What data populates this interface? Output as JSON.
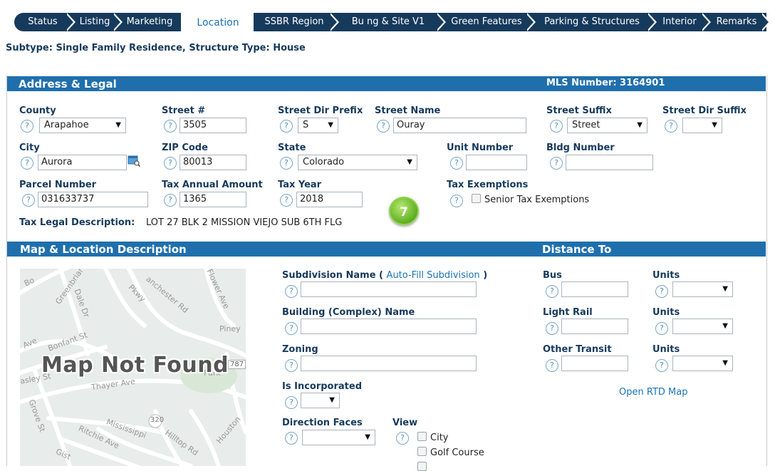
{
  "tabs": [
    "Status",
    "Listing",
    "Marketing",
    "Location",
    "SSBR Region",
    "Bu   ng & Site V1",
    "Green Features",
    "Parking & Structures",
    "Interior",
    "Remarks"
  ],
  "subtype": "Subtype: Single Family Residence, Structure Type: House",
  "address_section": {
    "title": "Address & Legal",
    "mls_number": "MLS Number: 3164901",
    "fields": {
      "county": {
        "label": "County",
        "value": "Arapahoe"
      },
      "street_number": {
        "label": "Street #",
        "value": "3505"
      },
      "street_dir_prefix": {
        "label": "Street Dir Prefix",
        "value": "S"
      },
      "street_name": {
        "label": "Street Name",
        "value": "Ouray"
      },
      "street_suffix": {
        "label": "Street Suffix",
        "value": "Street"
      },
      "street_dir_suffix": {
        "label": "Street Dir Suffix",
        "value": ""
      },
      "city": {
        "label": "City",
        "value": "Aurora"
      },
      "zip_code": {
        "label": "ZIP Code",
        "value": "80013"
      },
      "state": {
        "label": "State",
        "value": "Colorado"
      },
      "unit_number": {
        "label": "Unit Number",
        "value": ""
      },
      "bldg_number": {
        "label": "Bldg Number",
        "value": ""
      },
      "parcel_number": {
        "label": "Parcel Number",
        "value": "031633737"
      },
      "tax_annual_amount": {
        "label": "Tax Annual Amount",
        "value": "1365"
      },
      "tax_year": {
        "label": "Tax Year",
        "value": "2018"
      },
      "tax_exemptions": {
        "label": "Tax Exemptions",
        "option": "Senior Tax Exemptions"
      }
    },
    "tax_legal_label": "Tax Legal Description:",
    "tax_legal_value": "LOT 27 BLK 2 MISSION VIEJO SUB 6TH FLG",
    "step_badge": "7"
  },
  "map_section": {
    "title": "Map & Location Description",
    "distance_title": "Distance To",
    "map_not_found": "Map Not Found",
    "map_labels": {
      "dale": "Dale Dr",
      "greenbriar": "Greenbriar",
      "flower": "Flower Ave",
      "piney": "Piney",
      "manchester": "anchester Rd",
      "bonfant": "Bonfant St",
      "pkwy": "Pkwy",
      "ave": "Ave",
      "asley": "asley St",
      "thayer": "Thayer Ave",
      "park": "Park",
      "grove": "Grove St",
      "r320": "320",
      "mississippi": "Mississippi",
      "hilltop": "Hilltop Rd",
      "ritchie": "Ritchie Ave",
      "gist": "Gist",
      "houston": "Houston",
      "bo": "Bo",
      "n787": "787"
    },
    "subdivision_label": "Subdivision Name (",
    "auto_fill": "Auto-Fill Subdivision",
    "subdivision_close": ")",
    "building_label": "Building (Complex) Name",
    "zoning_label": "Zoning",
    "incorporated_label": "Is Incorporated",
    "direction_label": "Direction Faces",
    "view_label": "View",
    "view_options": [
      "City",
      "Golf Course"
    ],
    "distance": {
      "bus": "Bus",
      "light_rail": "Light Rail",
      "other_transit": "Other Transit",
      "units": "Units",
      "rtd_link": "Open RTD Map"
    }
  },
  "help_glyph": "?",
  "arrow_glyph": "▼"
}
